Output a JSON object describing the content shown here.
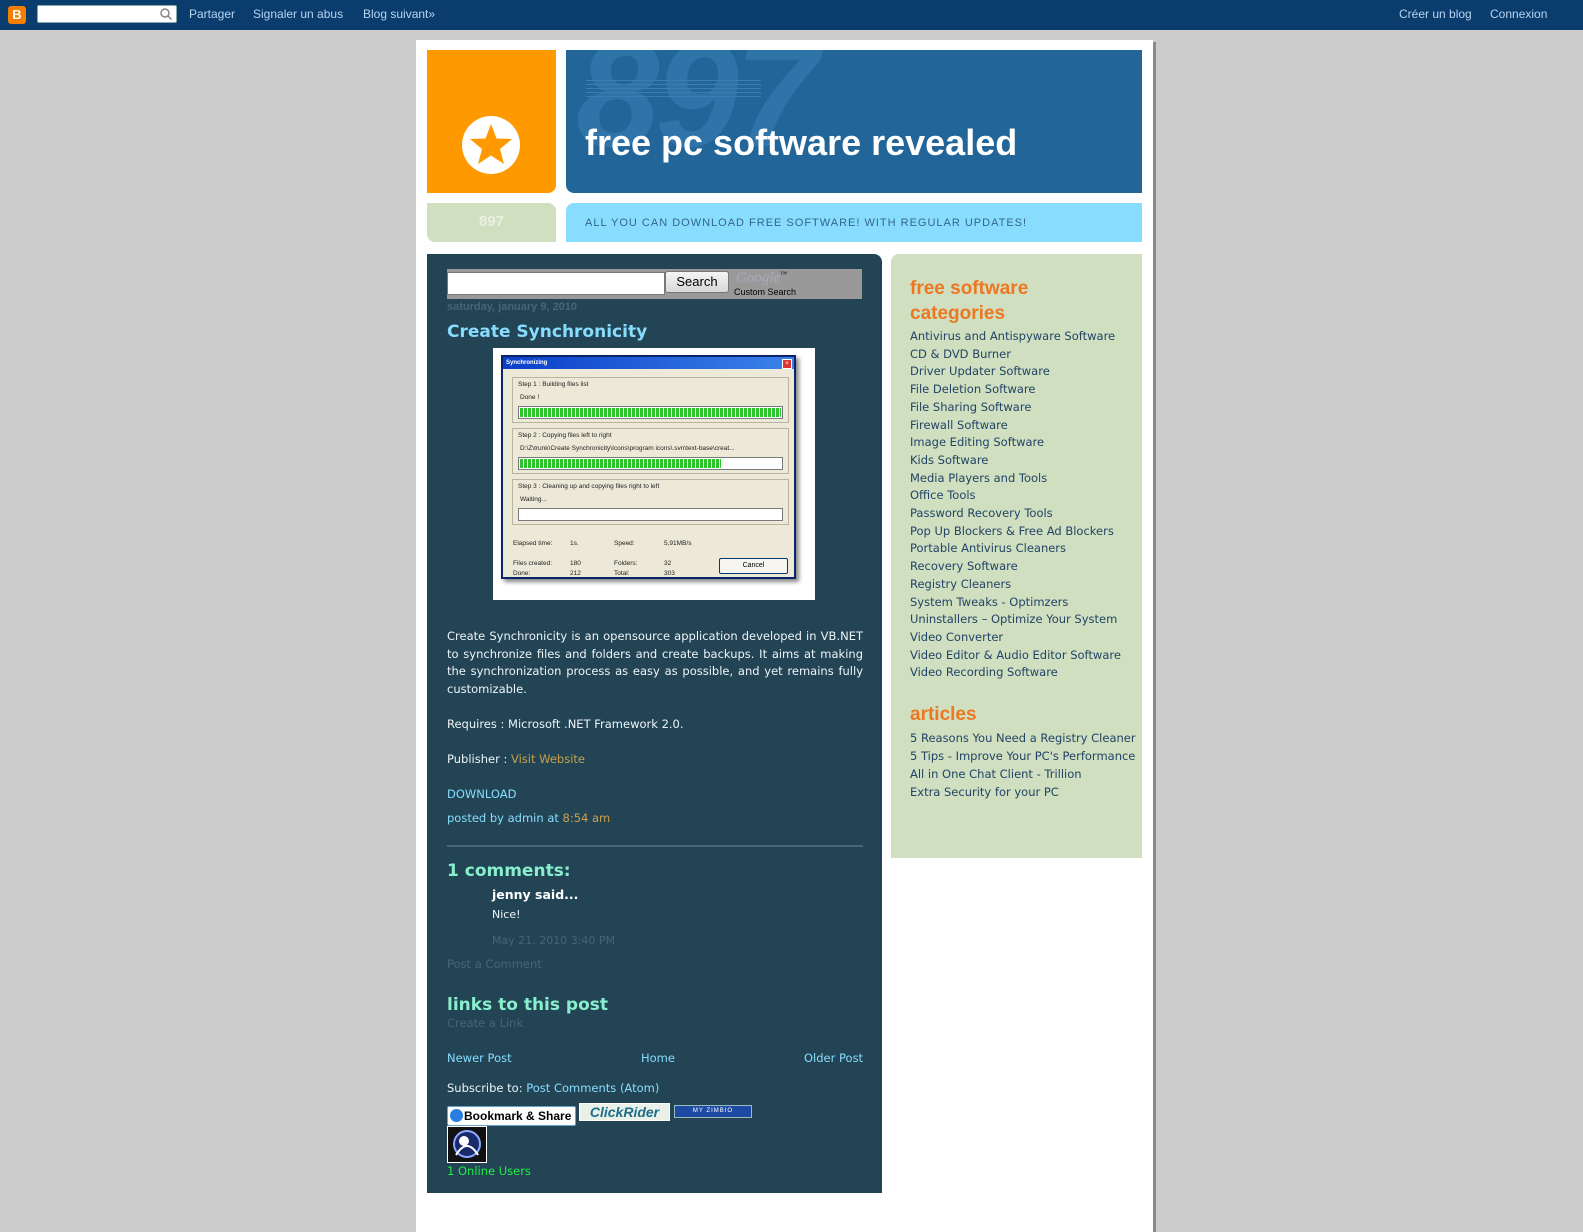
{
  "navbar": {
    "logo_letter": "B",
    "search_value": "",
    "links_left": [
      "Partager",
      "Signaler un abus",
      "Blog suivant»"
    ],
    "links_right": [
      "Créer un blog",
      "Connexion"
    ]
  },
  "header": {
    "title": "free pc software revealed",
    "big_number": "897",
    "badge_number": "897",
    "description": "ALL YOU CAN DOWNLOAD FREE SOFTWARE! WITH REGULAR UPDATES!"
  },
  "search": {
    "value": "",
    "button": "Search",
    "google": "Google",
    "tm": "™",
    "custom": "Custom Search"
  },
  "post": {
    "date": "saturday, january 9, 2010",
    "title": "Create Synchronicity",
    "screenshot": {
      "window_title": "Synchronizing",
      "step1_label": "Step 1 : Building files list",
      "step1_status": "Done !",
      "step1_progress": 1.0,
      "step2_label": "Step 2 : Copying files left to right",
      "step2_status": "D:\\Z\\trunk\\Create Synchronicity\\Icons\\program icons\\.svn\\text-base\\creat...",
      "step2_progress": 0.77,
      "step3_label": "Step 3 : Cleaning up and copying files right to left",
      "step3_status": "Waiting...",
      "step3_progress": 0,
      "elapsed_label": "Elapsed time:",
      "elapsed_value": "1s.",
      "speed_label": "Speed:",
      "speed_value": "5,91MB/s",
      "files_created_label": "Files created:",
      "files_created_value": "180",
      "folders_label": "Folders:",
      "folders_value": "32",
      "done_label": "Done:",
      "done_value": "212",
      "total_label": "Total:",
      "total_value": "303",
      "cancel": "Cancel"
    },
    "body": "Create Synchronicity is an opensource application developed in VB.NET to synchronize files and folders and create backups. It aims at making the synchronization process as easy as possible, and yet remains fully customizable.",
    "requires": "Requires : Microsoft .NET Framework 2.0.",
    "publisher_label": "Publisher : ",
    "publisher_link": "Visit Website",
    "download": "DOWNLOAD",
    "posted_by": "posted by admin at ",
    "posted_time": "8:54 am"
  },
  "comments": {
    "heading": "1 comments:",
    "items": [
      {
        "author": "jenny said...",
        "text": "Nice!",
        "timestamp": "May 21, 2010 3:40 PM"
      }
    ],
    "post_comment": "Post a Comment"
  },
  "backlinks": {
    "heading": "links to this post",
    "create": "Create a Link"
  },
  "pager": {
    "newer": "Newer Post",
    "home": "Home",
    "older": "Older Post"
  },
  "subscribe": {
    "label": "Subscribe to: ",
    "link": "Post Comments (Atom)"
  },
  "widgets": {
    "bookmark": "Bookmark & Share",
    "clickrider": "ClickRider",
    "zimbio": "MY ZIMBIO",
    "online_users": "1 Online Users"
  },
  "sidebar": {
    "categories_heading": "free software categories",
    "categories": [
      "Antivirus and Antispyware Software",
      "CD & DVD Burner",
      "Driver Updater Software",
      "File Deletion Software",
      "File Sharing Software",
      "Firewall Software",
      "Image Editing Software",
      "Kids Software",
      "Media Players and Tools",
      "Office Tools",
      "Password Recovery Tools",
      "Pop Up Blockers & Free Ad Blockers",
      "Portable Antivirus Cleaners",
      "Recovery Software",
      "Registry Cleaners",
      "System Tweaks - Optimzers",
      "Uninstallers – Optimize Your System",
      "Video Converter",
      "Video Editor & Audio Editor Software",
      "Video Recording Software"
    ],
    "articles_heading": "articles",
    "articles": [
      "5 Reasons You Need a Registry Cleaner",
      "5 Tips - Improve Your PC's Performance",
      "All in One Chat Client - Trillion",
      "Extra Security for your PC"
    ]
  },
  "colors": {
    "navbar": "#0a3c6e",
    "logo_orange": "#ff9900",
    "header_blue": "#226699",
    "desc_blue": "#88ddff",
    "main_bg": "#224455",
    "sidebar_bg": "#cfdfc0",
    "sidebar_heading": "#ee7722",
    "online_green": "#22ee44"
  }
}
